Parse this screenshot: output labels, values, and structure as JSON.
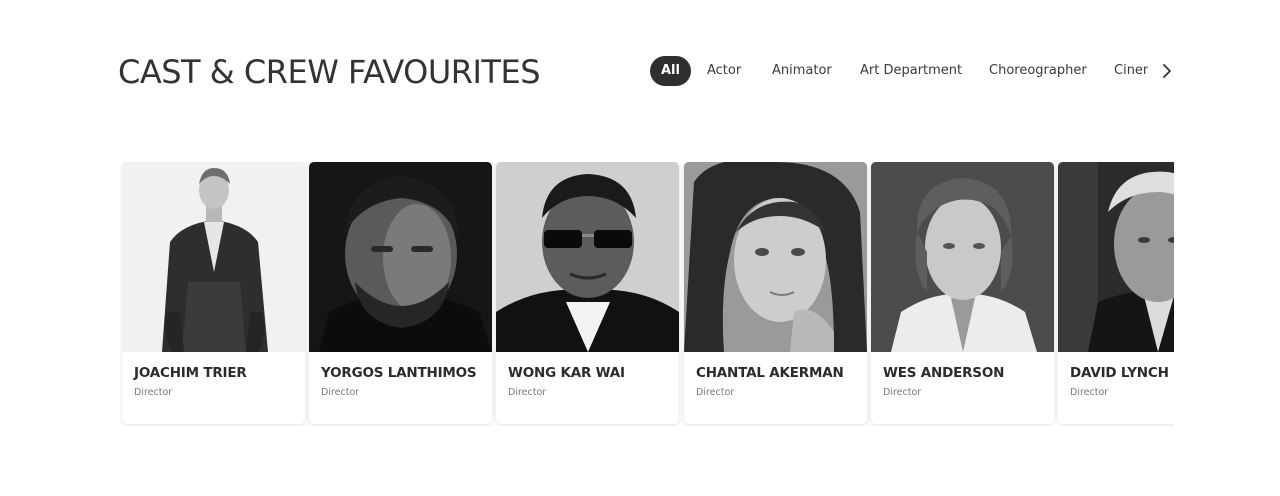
{
  "section": {
    "title": "CAST & CREW FAVOURITES"
  },
  "filters": {
    "items": [
      {
        "label": "All",
        "active": true
      },
      {
        "label": "Actor",
        "active": false
      },
      {
        "label": "Animator",
        "active": false
      },
      {
        "label": "Art Department",
        "active": false
      },
      {
        "label": "Choreographer",
        "active": false
      },
      {
        "label": "Cinematographer",
        "active": false
      }
    ],
    "next_icon": "chevron-right-icon"
  },
  "cards": [
    {
      "name": "JOACHIM TRIER",
      "role": "Director"
    },
    {
      "name": "YORGOS LANTHIMOS",
      "role": "Director"
    },
    {
      "name": "WONG KAR WAI",
      "role": "Director"
    },
    {
      "name": "CHANTAL AKERMAN",
      "role": "Director"
    },
    {
      "name": "WES ANDERSON",
      "role": "Director"
    },
    {
      "name": "DAVID LYNCH",
      "role": "Director"
    }
  ],
  "colors": {
    "accent": "#2f2f2f",
    "text": "#333333",
    "muted": "#777777",
    "background": "#ffffff"
  }
}
